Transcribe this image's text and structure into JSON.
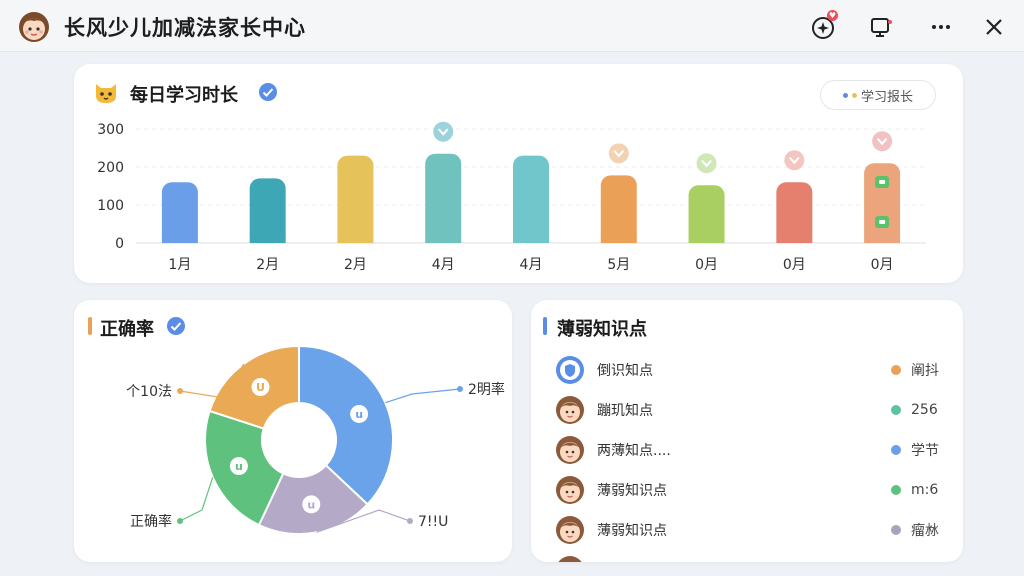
{
  "app": {
    "title": "长风少儿加减法家长中心"
  },
  "toolbar": {
    "badge_text": "♥",
    "icons": [
      "ai-sparkle-icon",
      "monitor-icon",
      "more-icon",
      "close-icon"
    ]
  },
  "study_card": {
    "title": "每日学习时长",
    "report_button": "学习报长"
  },
  "chart_data": {
    "type": "bar",
    "categories": [
      "1月",
      "2月",
      "2月",
      "4月",
      "4月",
      "5月",
      "0月",
      "0月",
      "0月"
    ],
    "values": [
      160,
      170,
      230,
      235,
      230,
      178,
      152,
      160,
      210
    ],
    "y_ticks": [
      "300",
      "200",
      "100",
      "0"
    ],
    "ylim": [
      0,
      300
    ],
    "grid": true,
    "colors": [
      "#6a9ee8",
      "#3ea7b5",
      "#e6c25a",
      "#6fc2bd",
      "#71c6cc",
      "#eba058",
      "#a9cf62",
      "#e57f6e",
      "#eba47c"
    ],
    "markers": [
      {
        "index": 3,
        "color": "#9bd3dd",
        "icon": "chevron-down-icon"
      },
      {
        "index": 5,
        "color": "#f3d2b4",
        "icon": "chevron-down-icon"
      },
      {
        "index": 6,
        "color": "#d0e8b8",
        "icon": "chevron-down-icon"
      },
      {
        "index": 7,
        "color": "#f3c6c2",
        "icon": "chevron-down-icon"
      },
      {
        "index": 8,
        "color": "#f2c2c2",
        "icon": "chevron-down-icon"
      }
    ]
  },
  "accuracy_card": {
    "title": "正确率",
    "donut": {
      "segments": [
        {
          "label": "2明率",
          "value": 37,
          "color": "#6aa3ea",
          "icon": "u"
        },
        {
          "label": "7!!U",
          "value": 20,
          "color": "#b5a9c8",
          "icon": "u"
        },
        {
          "label": "正确率",
          "value": 23,
          "color": "#5ec27e",
          "icon": "u"
        },
        {
          "label": "个10法",
          "value": 20,
          "color": "#eaa955",
          "icon": "U"
        }
      ]
    }
  },
  "weak_card": {
    "title": "薄弱知识点",
    "items": [
      {
        "name": "倒识知点",
        "value": "阐抖",
        "dot": "#eba058",
        "avatar": "shield-avatar-icon"
      },
      {
        "name": "蹦玑知点",
        "value": "256",
        "dot": "#5ec2a0",
        "avatar": "child-avatar-icon"
      },
      {
        "name": "两薄知点....",
        "value": "学节",
        "dot": "#6a9ee8",
        "avatar": "child-avatar-icon"
      },
      {
        "name": "薄弱知识点",
        "value": "m:6",
        "dot": "#5ec27e",
        "avatar": "child-avatar-icon"
      },
      {
        "name": "薄弱知识点",
        "value": "瘤沝",
        "dot": "#a9a3bd",
        "avatar": "child-avatar-icon"
      },
      {
        "name": "",
        "value": "",
        "dot": "#d8d8d8",
        "avatar": "child-avatar-icon"
      }
    ]
  }
}
